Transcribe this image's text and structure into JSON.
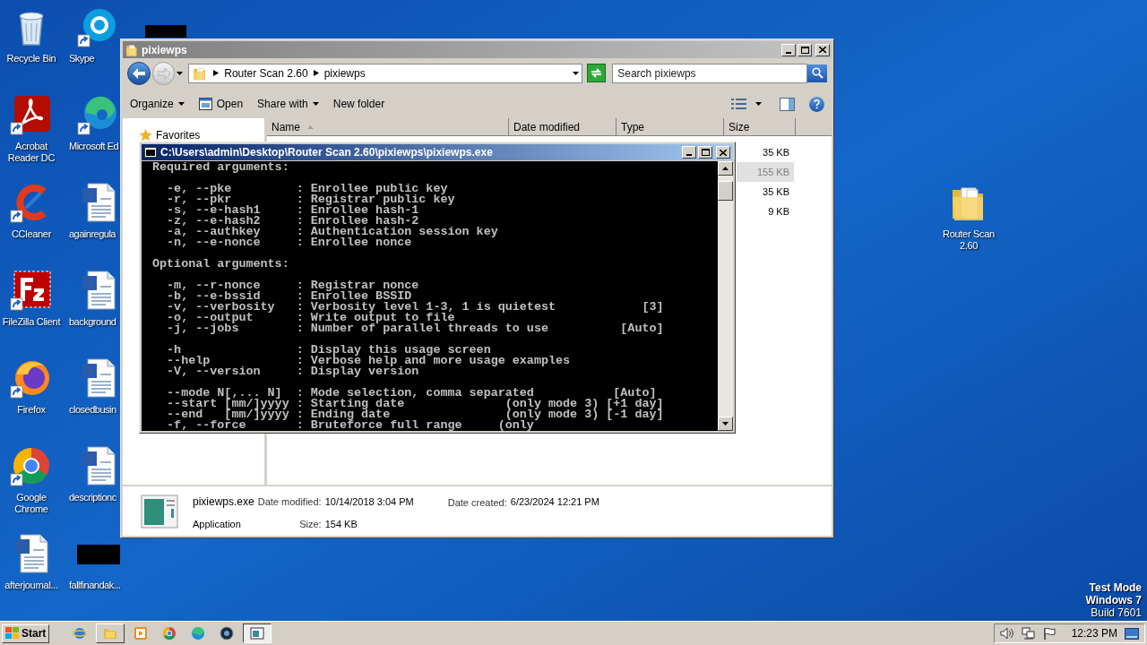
{
  "desktop": {
    "columns": [
      {
        "icons": [
          {
            "label": "Recycle Bin",
            "kind": "recycle_bin",
            "shortcut": false
          },
          {
            "label": "Acrobat Reader DC",
            "kind": "acrobat",
            "shortcut": true
          },
          {
            "label": "CCleaner",
            "kind": "ccleaner",
            "shortcut": true
          },
          {
            "label": "FileZilla Client",
            "kind": "filezilla",
            "shortcut": true
          },
          {
            "label": "Firefox",
            "kind": "firefox",
            "shortcut": true
          },
          {
            "label": "Google Chrome",
            "kind": "chrome",
            "shortcut": true
          },
          {
            "label": "afterjournal...",
            "kind": "word_document",
            "shortcut": false
          }
        ]
      },
      {
        "icons": [
          {
            "label": "Skype",
            "kind": "skype",
            "shortcut": true
          },
          {
            "label": "Microsoft Ed",
            "kind": "edge",
            "shortcut": true
          },
          {
            "label": "againregula",
            "kind": "word_document",
            "shortcut": false
          },
          {
            "label": "background",
            "kind": "word_document",
            "shortcut": false
          },
          {
            "label": "closedbusin",
            "kind": "word_document",
            "shortcut": false
          },
          {
            "label": "descriptionc",
            "kind": "word_document",
            "shortcut": false
          },
          {
            "label": "fallfinandak...",
            "kind": "black_file",
            "shortcut": false
          }
        ]
      }
    ],
    "hidden_icons": [
      {
        "kind": "black_file"
      }
    ],
    "right_icons": [
      {
        "label": "Router Scan 2.60",
        "kind": "folder",
        "shortcut": false
      }
    ]
  },
  "explorer": {
    "title": "pixiewps",
    "breadcrumb": [
      "Router Scan 2.60",
      "pixiewps"
    ],
    "search": {
      "placeholder": "Search pixiewps"
    },
    "toolbar": [
      {
        "label": "Organize",
        "kind": "menu"
      },
      {
        "label": "Open",
        "kind": "open"
      },
      {
        "label": "Share with",
        "kind": "menu"
      },
      {
        "label": "New folder",
        "kind": "plain"
      }
    ],
    "nav": [
      {
        "label": "Favorites"
      }
    ],
    "columns": [
      {
        "label": "Name",
        "sorted": true
      },
      {
        "label": "Date modified",
        "sorted": false
      },
      {
        "label": "Type",
        "sorted": false
      },
      {
        "label": "Size",
        "sorted": false
      }
    ],
    "rows": [
      {
        "size": "35 KB",
        "selected": false
      },
      {
        "size": "155 KB",
        "selected": true
      },
      {
        "size": "35 KB",
        "selected": false
      },
      {
        "size": "9 KB",
        "selected": false
      }
    ],
    "details": {
      "name": "pixiewps.exe",
      "type": "Application",
      "fields": [
        {
          "label": "Date modified:",
          "value": "10/14/2018 3:04 PM"
        },
        {
          "label": "Date created:",
          "value": "6/23/2024 12:21 PM"
        },
        {
          "label": "Size:",
          "value": "154 KB"
        }
      ]
    }
  },
  "console": {
    "title": "C:\\Users\\admin\\Desktop\\Router Scan 2.60\\pixiewps\\pixiewps.exe",
    "blocks": [
      [
        "Required arguments:"
      ],
      [
        "  -e, --pke         : Enrollee public key",
        "  -r, --pkr         : Registrar public key",
        "  -s, --e-hash1     : Enrollee hash-1",
        "  -z, --e-hash2     : Enrollee hash-2",
        "  -a, --authkey     : Authentication session key",
        "  -n, --e-nonce     : Enrollee nonce"
      ],
      [
        "Optional arguments:"
      ],
      [
        "  -m, --r-nonce     : Registrar nonce",
        "  -b, --e-bssid     : Enrollee BSSID",
        "  -v, --verbosity   : Verbosity level 1-3, 1 is quietest            [3]",
        "  -o, --output      : Write output to file",
        "  -j, --jobs        : Number of parallel threads to use          [Auto]"
      ],
      [
        "  -h                : Display this usage screen",
        "  --help            : Verbose help and more usage examples",
        "  -V, --version     : Display version"
      ],
      [
        "  --mode N[,... N]  : Mode selection, comma separated           [Auto]",
        "  --start [mm/]yyyy : Starting date              (only mode 3) [+1 day]",
        "  --end   [mm/]yyyy : Ending date                (only mode 3) [-1 day]",
        "  -f, --force       : Bruteforce full range     (only"
      ]
    ]
  },
  "taskbar": {
    "start": "Start",
    "apps": [
      {
        "kind": "ie",
        "open": false,
        "active": false
      },
      {
        "kind": "explorer",
        "open": true,
        "active": false
      },
      {
        "kind": "media",
        "open": false,
        "active": false
      },
      {
        "kind": "chrome",
        "open": false,
        "active": false
      },
      {
        "kind": "edge",
        "open": false,
        "active": false
      },
      {
        "kind": "disc",
        "open": false,
        "active": false
      },
      {
        "kind": "window",
        "open": true,
        "active": true
      }
    ],
    "clock": "12:23 PM"
  },
  "os_notice": [
    {
      "text": "Test Mode",
      "bold": true
    },
    {
      "text": "Windows 7",
      "bold": true
    },
    {
      "text": "Build 7601",
      "bold": false
    }
  ]
}
